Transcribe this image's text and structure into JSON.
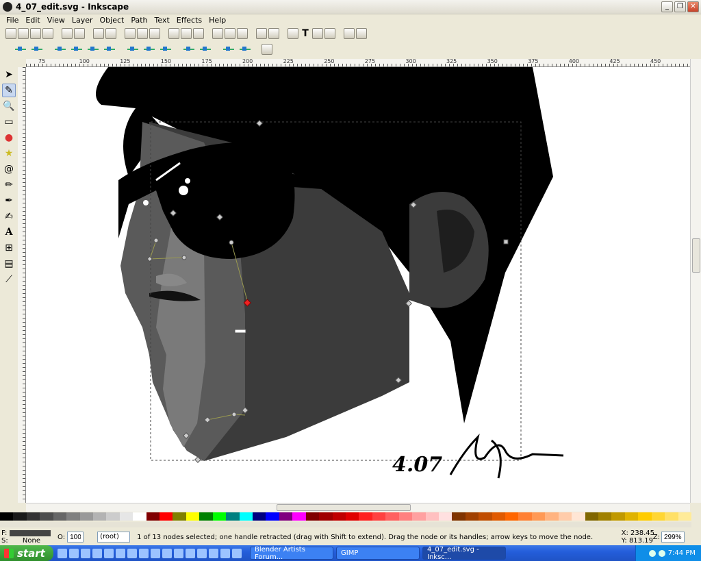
{
  "window": {
    "title": "4_07_edit.svg - Inkscape",
    "buttons": [
      "_",
      "❐",
      "✕"
    ]
  },
  "menubar": [
    "File",
    "Edit",
    "View",
    "Layer",
    "Object",
    "Path",
    "Text",
    "Effects",
    "Help"
  ],
  "ruler_top_ticks": [
    "75",
    "100",
    "125",
    "150",
    "175",
    "200",
    "225",
    "250",
    "275",
    "300",
    "325",
    "350",
    "375",
    "400",
    "425",
    "450"
  ],
  "artwork_signature": {
    "date": "4.07"
  },
  "statusbar": {
    "fill_label": "F:",
    "stroke_label": "S:",
    "stroke_value": "None",
    "opacity_label": "O:",
    "opacity_value": "100",
    "layer_value": "(root)",
    "message": "1 of 13 nodes selected; one handle retracted (drag with Shift to extend). Drag the node or its handles; arrow keys to move the node.",
    "x_coord": "X: 238.45",
    "y_coord": "Y: 813.19",
    "zoom_label": "Z:",
    "zoom_value": "299%"
  },
  "taskbar": {
    "start_label": "start",
    "tasks": [
      {
        "label": "Blender Artists Forum..."
      },
      {
        "label": "GIMP"
      },
      {
        "label": "4_07_edit.svg - Inksc..."
      }
    ],
    "clock": "7:44 PM"
  },
  "palette_colors": [
    "#000000",
    "#1a1a1a",
    "#333333",
    "#4d4d4d",
    "#666666",
    "#808080",
    "#999999",
    "#b3b3b3",
    "#cccccc",
    "#e6e6e6",
    "#ffffff",
    "#800000",
    "#ff0000",
    "#808000",
    "#ffff00",
    "#008000",
    "#00ff00",
    "#008080",
    "#00ffff",
    "#000080",
    "#0000ff",
    "#800080",
    "#ff00ff",
    "#800000",
    "#a00000",
    "#c00000",
    "#e00000",
    "#ff2020",
    "#ff4040",
    "#ff6060",
    "#ff8080",
    "#ffa0a0",
    "#ffc0c0",
    "#ffe0e0",
    "#803300",
    "#a04000",
    "#c04d00",
    "#e05a00",
    "#ff6600",
    "#ff8033",
    "#ff9955",
    "#ffb380",
    "#ffccaa",
    "#ffe6d5",
    "#806600",
    "#a08000",
    "#c09900",
    "#e0b300",
    "#ffcc00",
    "#ffd633",
    "#ffe066",
    "#ffeb99"
  ],
  "colors": {
    "accent": "#245edb",
    "canvas_bg": "#ffffff",
    "chrome_bg": "#ece9d8"
  }
}
